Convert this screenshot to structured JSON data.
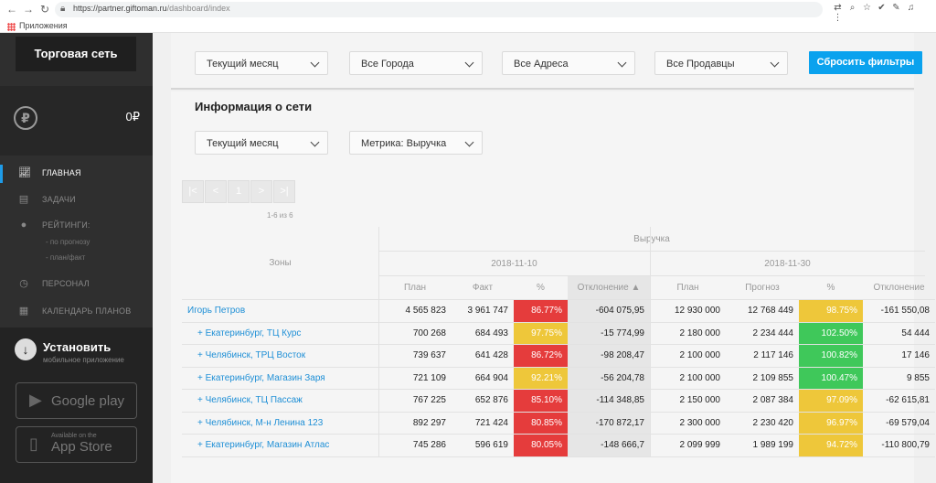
{
  "browser": {
    "url_host": "https://partner.giftoman.ru",
    "url_path": "/dashboard/index",
    "bookmark_apps_label": "Приложения"
  },
  "sidebar": {
    "brand": "Торговая сеть",
    "balance": "0₽",
    "balance_icon": "ruble-icon",
    "menu": [
      {
        "label": "ГЛАВНАЯ",
        "icon": "chart-icon",
        "active": true
      },
      {
        "label": "ЗАДАЧИ",
        "icon": "document-icon",
        "active": false
      },
      {
        "label": "РЕЙТИНГИ:",
        "icon": "badge-icon",
        "active": false
      },
      {
        "label": "ПЕРСОНАЛ",
        "icon": "clock-icon",
        "active": false
      },
      {
        "label": "КАЛЕНДАРЬ ПЛАНОВ",
        "icon": "calendar-icon",
        "active": false
      }
    ],
    "ratings_sub": [
      "- по прогнозу",
      "- план/факт"
    ],
    "install": {
      "title": "Установить",
      "subtitle": "мобильное приложение",
      "google_play": "Google play",
      "app_store_small": "Available on the",
      "app_store_big": "App Store"
    }
  },
  "filters": {
    "period": "Текущий месяц",
    "city": "Все Города",
    "address": "Все Адреса",
    "seller": "Все Продавцы",
    "reset_label": "Сбросить фильтры"
  },
  "info": {
    "title": "Информация о сети",
    "period": "Текущий месяц",
    "metric": "Метрика: Выручка"
  },
  "pager": {
    "first": "|<",
    "prev": "<",
    "page": "1",
    "next": ">",
    "last": ">|",
    "info": "1-6 из 6"
  },
  "table": {
    "group_header": "Выручка",
    "zones_header": "Зоны",
    "date1": "2018-11-10",
    "date2": "2018-11-30",
    "cols1": [
      "План",
      "Факт",
      "%",
      "Отклонение ▲"
    ],
    "cols2": [
      "План",
      "Прогноз",
      "%",
      "Отклонение"
    ],
    "rows": [
      {
        "zone": "Игорь Петров",
        "sub": false,
        "p1": "4 565 823",
        "f1": "3 961 747",
        "pct1": "86.77%",
        "c1": "red",
        "d1": "-604 075,95",
        "p2": "12 930 000",
        "f2": "12 768 449",
        "pct2": "98.75%",
        "c2": "yellow",
        "d2": "-161 550,08"
      },
      {
        "zone": "+ Екатеринбург, ТЦ Курс",
        "sub": true,
        "p1": "700 268",
        "f1": "684 493",
        "pct1": "97.75%",
        "c1": "yellow",
        "d1": "-15 774,99",
        "p2": "2 180 000",
        "f2": "2 234 444",
        "pct2": "102.50%",
        "c2": "green",
        "d2": "54 444"
      },
      {
        "zone": "+ Челябинск, ТРЦ Восток",
        "sub": true,
        "p1": "739 637",
        "f1": "641 428",
        "pct1": "86.72%",
        "c1": "red",
        "d1": "-98 208,47",
        "p2": "2 100 000",
        "f2": "2 117 146",
        "pct2": "100.82%",
        "c2": "green",
        "d2": "17 146"
      },
      {
        "zone": "+ Екатеринбург, Магазин Заря",
        "sub": true,
        "p1": "721 109",
        "f1": "664 904",
        "pct1": "92.21%",
        "c1": "yellow",
        "d1": "-56 204,78",
        "p2": "2 100 000",
        "f2": "2 109 855",
        "pct2": "100.47%",
        "c2": "green",
        "d2": "9 855"
      },
      {
        "zone": "+ Челябинск, ТЦ Пассаж",
        "sub": true,
        "p1": "767 225",
        "f1": "652 876",
        "pct1": "85.10%",
        "c1": "red",
        "d1": "-114 348,85",
        "p2": "2 150 000",
        "f2": "2 087 384",
        "pct2": "97.09%",
        "c2": "yellow",
        "d2": "-62 615,81"
      },
      {
        "zone": "+ Челябинск, М-н Ленина 123",
        "sub": true,
        "p1": "892 297",
        "f1": "721 424",
        "pct1": "80.85%",
        "c1": "red",
        "d1": "-170 872,17",
        "p2": "2 300 000",
        "f2": "2 230 420",
        "pct2": "96.97%",
        "c2": "yellow",
        "d2": "-69 579,04"
      },
      {
        "zone": "+ Екатеринбург, Магазин Атлас",
        "sub": true,
        "p1": "745 286",
        "f1": "596 619",
        "pct1": "80.05%",
        "c1": "red",
        "d1": "-148 666,7",
        "p2": "2 099 999",
        "f2": "1 989 199",
        "pct2": "94.72%",
        "c2": "yellow",
        "d2": "-110 800,79"
      }
    ]
  }
}
